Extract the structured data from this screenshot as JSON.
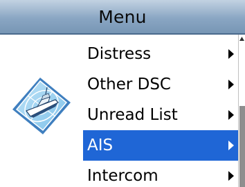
{
  "header": {
    "title": "Menu"
  },
  "app_icon": {
    "icon": "boat-radar-chart-icon"
  },
  "menu": {
    "items": [
      {
        "label": "Distress",
        "icon": "chevron-right-icon"
      },
      {
        "label": "Other DSC",
        "icon": "chevron-right-icon"
      },
      {
        "label": "Unread List",
        "icon": "chevron-right-icon"
      },
      {
        "label": "AIS",
        "icon": "chevron-right-icon",
        "selected": true
      },
      {
        "label": "Intercom",
        "icon": "chevron-right-icon"
      }
    ]
  },
  "scrollbar": {
    "icon": "scroll-up-icon"
  },
  "colors": {
    "selection": "#1f66d6",
    "title_bar": "#8aa6c3",
    "scroll_thumb": "#8e8e8e"
  }
}
